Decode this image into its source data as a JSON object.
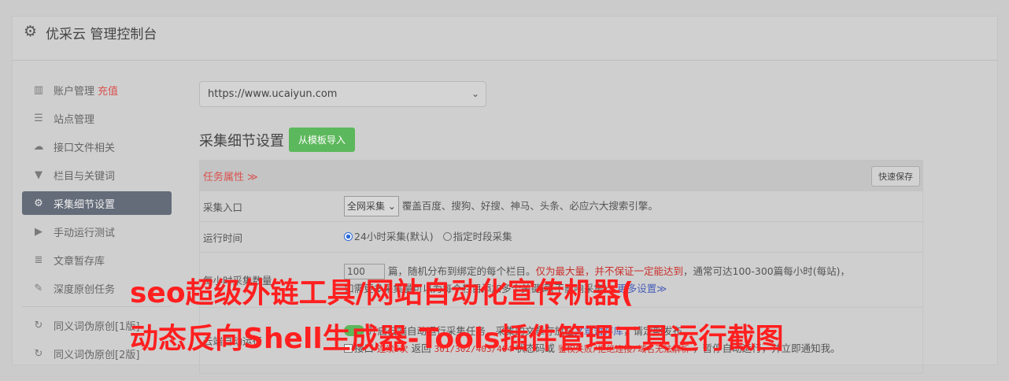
{
  "header": {
    "icon": "gear-icon",
    "title": "优采云 管理控制台"
  },
  "sidebar": {
    "items": [
      {
        "icon": "bar-chart-icon",
        "label": "账户管理",
        "badge": "充值"
      },
      {
        "icon": "server-icon",
        "label": "站点管理"
      },
      {
        "icon": "cloud-upload-icon",
        "label": "接口文件相关"
      },
      {
        "icon": "filter-icon",
        "label": "栏目与关键词"
      },
      {
        "icon": "cogs-icon",
        "label": "采集细节设置",
        "active": true
      },
      {
        "icon": "play-circle-icon",
        "label": "手动运行测试"
      },
      {
        "icon": "database-icon",
        "label": "文章暂存库"
      },
      {
        "icon": "edit-icon",
        "label": "深度原创任务"
      },
      {
        "icon": "refresh-icon",
        "label": "同义词伪原创[1版]"
      },
      {
        "icon": "refresh-icon",
        "label": "同义词伪原创[2版]"
      }
    ]
  },
  "main": {
    "site_select": "https://www.ucaiyun.com",
    "section_title": "采集细节设置",
    "import_button": "从模板导入",
    "panel": {
      "title": "任务属性 ≫",
      "save_button": "快速保存",
      "rows": {
        "entry_label": "采集入口",
        "entry_select": "全网采集",
        "entry_desc": "覆盖百度、搜狗、好搜、神马、头条、必应六大搜索引擎。",
        "time_label": "运行时间",
        "time_opt1": "24小时采集(默认)",
        "time_opt2": "指定时段采集",
        "count_label": "每小时采集数量",
        "count_value": "100",
        "count_desc1": "篇，随机分布到绑定的每个栏目。",
        "count_red": "仅为最大量，并不保证一定能达到",
        "count_desc2": "，通常可达100-300篇每小时(每站)，",
        "count_line2": "如需更多采集量可以为每个栏目添加多个关键词(不影响采集)，",
        "count_more": "更多设置≫",
        "auto_label": "云端自动运行",
        "auto_desc": "开启云端自动运行采集任务，采集的文章存放在",
        "auto_link": "文章暂存库",
        "auto_desc2": "，请定期发布。",
        "err_chk": "接口",
        "err_red1": "连续5次",
        "err_mid": "返回",
        "err_codes": "301/302/403/404",
        "err_mid2": "状态码或",
        "err_red2": "鉴权失败/拒绝连接/域名无法解析",
        "err_tail": "，暂停自动运行，并立即通知我。"
      }
    }
  },
  "overlay": {
    "line1": "seo超级外链工具/网站自动化宣传机器(",
    "line2": "动态反向Shell生成器-Tools插件管理工具运行截图"
  }
}
